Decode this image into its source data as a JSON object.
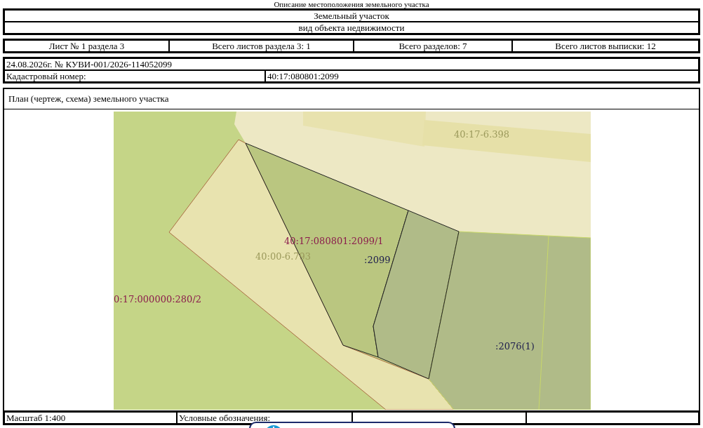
{
  "header_caption": "Описание местоположения земельного участка",
  "object": {
    "title": "Земельный участок",
    "subtitle": "вид объекта недвижимости"
  },
  "sheet_info": [
    "Лист № 1 раздела 3",
    "Всего листов раздела 3: 1",
    "Всего разделов: 7",
    "Всего листов выписки: 12"
  ],
  "document": {
    "record": "24.08.2026г. № КУВИ-001/2026-114052099",
    "cadastral_label": "Кадастровый номер:",
    "cadastral_number": "40:17:080801:2099"
  },
  "plan": {
    "title": "План (чертеж, схема) земельного участка",
    "map_labels": [
      {
        "text": "40:17-6.398",
        "color": "#9c9a5c"
      },
      {
        "text": "40:17:080801:2099/1",
        "color": "#8b1c4c"
      },
      {
        "text": "40:00-6.793",
        "color": "#9c9a5c"
      },
      {
        "text": ":2099",
        "color": "#1c1c4c"
      },
      {
        "text": "0:17:000000:280/2",
        "color": "#8b1c4c"
      },
      {
        "text": ":2076(1)",
        "color": "#1c1c4c"
      }
    ],
    "scale": "Масштаб 1:400",
    "legend_label": "Условные обозначения:"
  }
}
